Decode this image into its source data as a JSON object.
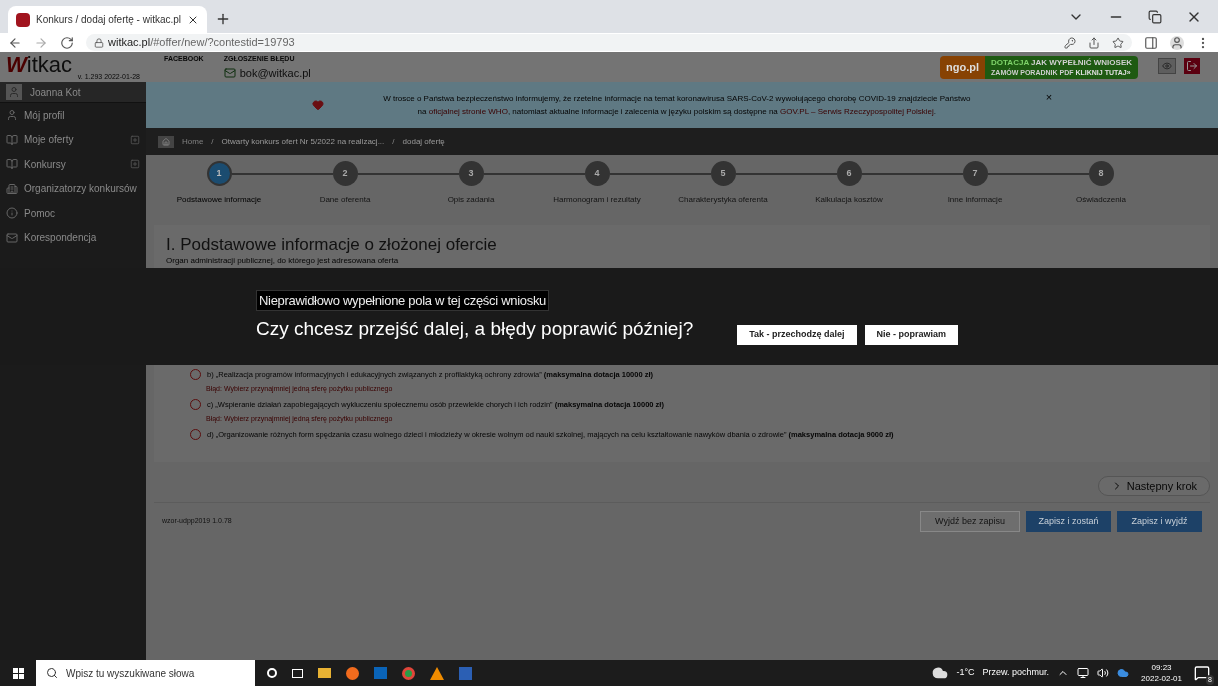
{
  "browser": {
    "tab_title": "Konkurs / dodaj ofertę - witkac.pl",
    "url_host": "witkac.pl",
    "url_path": "/#offer/new/?contestid=19793"
  },
  "header": {
    "logo": "Witkac",
    "version": "v. 1.293 2022-01-28",
    "facebook": "FACEBOOK",
    "report_label": "ZGŁOSZENIE BŁĘDU",
    "email": "bok@witkac.pl",
    "ad": {
      "brand": "ngo.pl",
      "tag": "DOTACJA",
      "headline": "JAK WYPEŁNIĆ WNIOSEK",
      "sub": "ZAMÓW PORADNIK PDF",
      "cta": "KLIKNIJ TUTAJ»"
    }
  },
  "sidebar": {
    "user": "Joanna Kot",
    "items": [
      {
        "label": "Mój profil",
        "expandable": false
      },
      {
        "label": "Moje oferty",
        "expandable": true
      },
      {
        "label": "Konkursy",
        "expandable": true
      },
      {
        "label": "Organizatorzy konkursów",
        "expandable": false
      },
      {
        "label": "Pomoc",
        "expandable": false
      },
      {
        "label": "Korespondencja",
        "expandable": false
      }
    ]
  },
  "notice": {
    "line1": "W trosce o Państwa bezpieczeństwo informujemy, że rzetelne informacje na temat koronawirusa SARS-CoV-2 wywołującego chorobę COVID-19 znajdziecie Państwo",
    "pre": "na",
    "link1": "oficjalnej stronie WHO",
    "mid": ", natomiast aktualne informacje i zalecenia w języku polskim są dostępne na",
    "link2": "GOV.PL – Serwis Rzeczypospolitej Polskiej",
    "post": ".",
    "close": "×"
  },
  "breadcrumb": [
    "Home",
    "Otwarty konkurs ofert Nr 5/2022 na realizacj...",
    "dodaj ofertę"
  ],
  "breadcrumb_separator": "/",
  "steps": [
    {
      "number": "1",
      "label": "Podstawowe informacje",
      "selected": true
    },
    {
      "number": "2",
      "label": "Dane oferenta",
      "selected": false
    },
    {
      "number": "3",
      "label": "Opis zadania",
      "selected": false
    },
    {
      "number": "4",
      "label": "Harmonogram i rezultaty",
      "selected": false
    },
    {
      "number": "5",
      "label": "Charakterystyka oferenta",
      "selected": false
    },
    {
      "number": "6",
      "label": "Kalkulacja kosztów",
      "selected": false
    },
    {
      "number": "7",
      "label": "Inne informacje",
      "selected": false
    },
    {
      "number": "8",
      "label": "Oświadczenia",
      "selected": false
    }
  ],
  "section": {
    "title": "I. Podstawowe informacje o złożonej ofercie",
    "subtitle": "Organ administracji publicznej, do którego jest adresowana oferta",
    "options": [
      {
        "text": "b) „Realizacja programów informacyjnych i edukacyjnych związanych z profilaktyką ochrony zdrowia” **(maksymalna dotacja 10000 zł)**",
        "error": "Błąd: Wybierz przynajmniej jedną sferę pożytku publicznego",
        "checked": false
      },
      {
        "text": "c) „Wspieranie działań zapobiegających wykluczeniu społecznemu osób przewlekle chorych i ich rodzin” **(maksymalna dotacja 10000 zł)**",
        "error": "Błąd: Wybierz przynajmniej jedną sferę pożytku publicznego",
        "checked": false
      },
      {
        "text": "d) „Organizowanie różnych form spędzania czasu wolnego dzieci i młodzieży w okresie wolnym od nauki szkolnej, mających na celu kształtowanie nawyków dbania o zdrowie” **(maksymalna dotacja 9000 zł)**",
        "checked": false
      }
    ]
  },
  "next_button": "Następny krok",
  "footer": {
    "version": "wzor-udpp2019 1.0.78",
    "buttons": [
      {
        "label": "Wyjdź bez zapisu",
        "kind": "outline"
      },
      {
        "label": "Zapisz i zostań",
        "kind": "primary"
      },
      {
        "label": "Zapisz i wyjdź",
        "kind": "primary"
      }
    ]
  },
  "modal": {
    "message": "Nieprawidłowo wypełnione pola w tej części wniosku",
    "question": "Czy chcesz przejść dalej, a błędy poprawić później?",
    "buttons": [
      "Tak - przechodzę dalej",
      "Nie - poprawiam"
    ]
  },
  "taskbar": {
    "search_placeholder": "Wpisz tu wyszukiwane słowa",
    "temperature": "-1°C",
    "weather": "Przew. pochmur.",
    "time": "09:23",
    "date": "2022-02-01",
    "notifications": "8"
  }
}
